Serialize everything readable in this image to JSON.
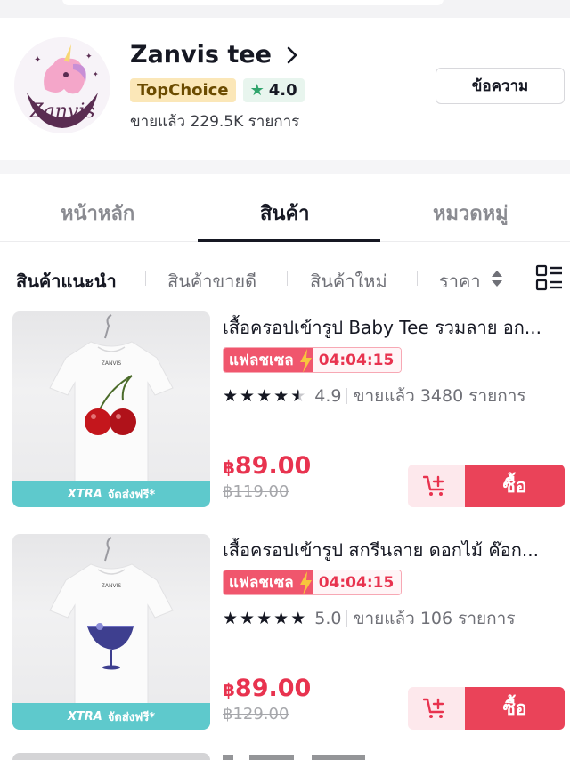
{
  "shop": {
    "name": "Zanvis tee",
    "badge_label": "TopChoice",
    "rating": "4.0",
    "sold_total": "ขายแล้ว 229.5K รายการ",
    "message_button": "ข้อความ",
    "logo_text": "Zanvis"
  },
  "tabs": [
    {
      "label": "หน้าหลัก",
      "active": false
    },
    {
      "label": "สินค้า",
      "active": true
    },
    {
      "label": "หมวดหมู่",
      "active": false
    }
  ],
  "sort": {
    "recommended": "สินค้าแนะนำ",
    "best_selling": "สินค้าขายดี",
    "new": "สินค้าใหม่",
    "price": "ราคา"
  },
  "products": [
    {
      "title": "เสื้อครอปเข้ารูป Baby Tee รวมลาย อก...",
      "flash_label": "แฟลชเซล",
      "flash_time": "04:04:15",
      "rating": "4.9",
      "rating_stars": 4.5,
      "sold": "ขายแล้ว 3480 รายการ",
      "currency": "฿",
      "price": "89.00",
      "old_price": "฿119.00",
      "xtra_label": "XTRA",
      "xtra_text": "จัดส่งฟรี*",
      "buy_label": "ซื้อ",
      "image_icon": "cherry-tee-icon"
    },
    {
      "title": "เสื้อครอปเข้ารูป สกรีนลาย ดอกไม้ ค๊อก...",
      "flash_label": "แฟลชเซล",
      "flash_time": "04:04:15",
      "rating": "5.0",
      "rating_stars": 5,
      "sold": "ขายแล้ว 106 รายการ",
      "currency": "฿",
      "price": "89.00",
      "old_price": "฿129.00",
      "xtra_label": "XTRA",
      "xtra_text": "จัดส่งฟรี*",
      "buy_label": "ซื้อ",
      "image_icon": "cocktail-tee-icon"
    }
  ],
  "colors": {
    "accent": "#ea4359",
    "price": "#e8334f",
    "xtra": "#5ec9cc",
    "topchoice_bg": "#fbe7b8",
    "rating_star": "#30a46c"
  }
}
